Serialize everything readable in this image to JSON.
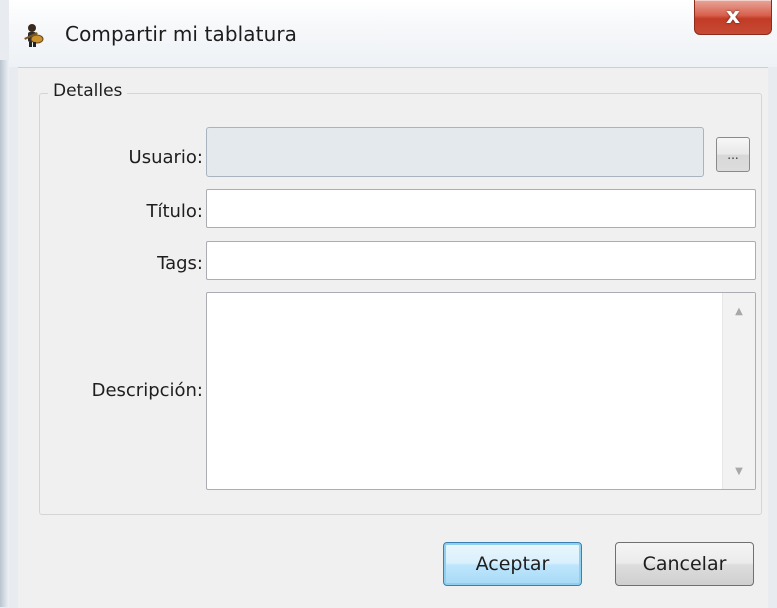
{
  "window": {
    "title": "Compartir mi tablatura",
    "close_glyph": "x",
    "app_icon": "guitarist-icon"
  },
  "group": {
    "legend": "Detalles"
  },
  "fields": {
    "usuario_label": "Usuario:",
    "usuario_value": "",
    "browse_label": "...",
    "titulo_label": "Título:",
    "titulo_value": "",
    "tags_label": "Tags:",
    "tags_value": "",
    "descripcion_label": "Descripción:",
    "descripcion_value": ""
  },
  "buttons": {
    "ok": "Aceptar",
    "cancel": "Cancelar"
  },
  "colors": {
    "ok_highlight": "#bee6fd",
    "close_red": "#c23b26"
  }
}
